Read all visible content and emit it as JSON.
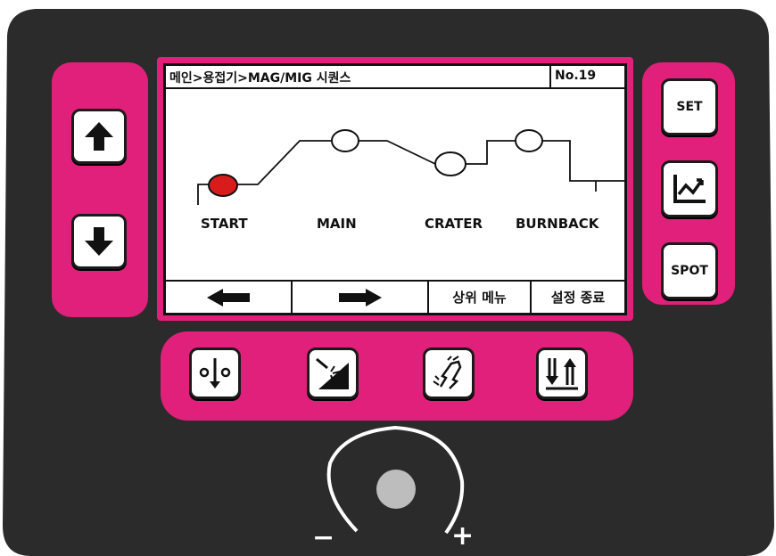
{
  "colors": {
    "body": "#2b2b2b",
    "accent": "#e0207a",
    "screen_border": "#e0207a",
    "start_marker": "#d81c1c"
  },
  "screen": {
    "breadcrumb": "메인>용접기>MAG/MIG 시퀀스",
    "program_no": "No.19",
    "stages": [
      "START",
      "MAIN",
      "CRATER",
      "BURNBACK"
    ],
    "selected_stage": "START",
    "softkeys": {
      "left": "left-arrow-icon",
      "right": "right-arrow-icon",
      "upper_menu": "상위 메뉴",
      "exit_settings": "설정 종료"
    }
  },
  "left_buttons": [
    "up-arrow-icon",
    "down-arrow-icon"
  ],
  "right_buttons": {
    "set": "SET",
    "graph": "graph-icon",
    "spot": "SPOT"
  },
  "bottom_buttons": [
    "torch-mode-icon",
    "welding-process-icon",
    "wire-inch-icon",
    "sequence-icon"
  ],
  "knob": {
    "minus": "−",
    "plus": "+"
  }
}
